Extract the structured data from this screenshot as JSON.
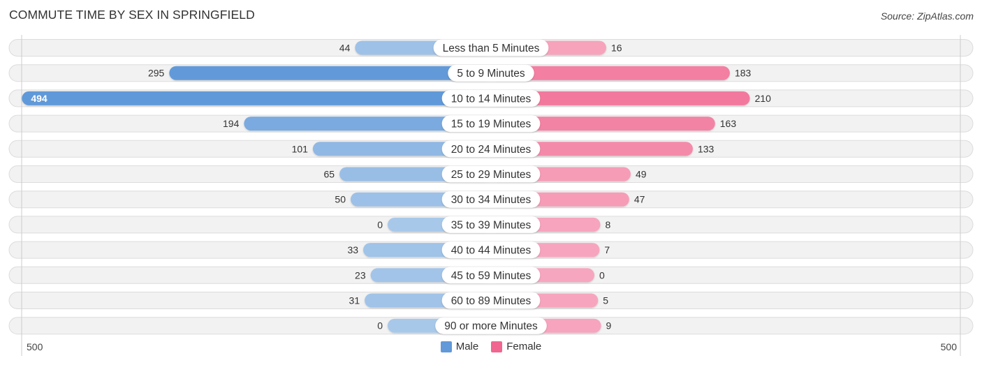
{
  "header": {
    "title": "COMMUTE TIME BY SEX IN SPRINGFIELD",
    "source": "Source: ZipAtlas.com"
  },
  "colors": {
    "male_strong": "#6199d9",
    "male_light": "#a8c8ea",
    "female_strong": "#f0668f",
    "female_light": "#f7a6bf",
    "track": "#f2f2f2",
    "label_bg": "#ffffff"
  },
  "legend": {
    "male": "Male",
    "female": "Female"
  },
  "axis": {
    "left_max_label": "500",
    "right_max_label": "500"
  },
  "chart_data": {
    "type": "bar",
    "orientation": "horizontal-diverging",
    "title": "COMMUTE TIME BY SEX IN SPRINGFIELD",
    "xlabel": "",
    "ylabel": "",
    "xlim": [
      -500,
      500
    ],
    "legend_position": "bottom-center",
    "grid": false,
    "categories": [
      "Less than 5 Minutes",
      "5 to 9 Minutes",
      "10 to 14 Minutes",
      "15 to 19 Minutes",
      "20 to 24 Minutes",
      "25 to 29 Minutes",
      "30 to 34 Minutes",
      "35 to 39 Minutes",
      "40 to 44 Minutes",
      "45 to 59 Minutes",
      "60 to 89 Minutes",
      "90 or more Minutes"
    ],
    "series": [
      {
        "name": "Male",
        "side": "left",
        "values": [
          44,
          295,
          494,
          194,
          101,
          65,
          50,
          0,
          33,
          23,
          31,
          0
        ]
      },
      {
        "name": "Female",
        "side": "right",
        "values": [
          16,
          183,
          210,
          163,
          133,
          49,
          47,
          8,
          7,
          0,
          5,
          9
        ]
      }
    ],
    "tick_labels": [
      "500",
      "500"
    ]
  }
}
